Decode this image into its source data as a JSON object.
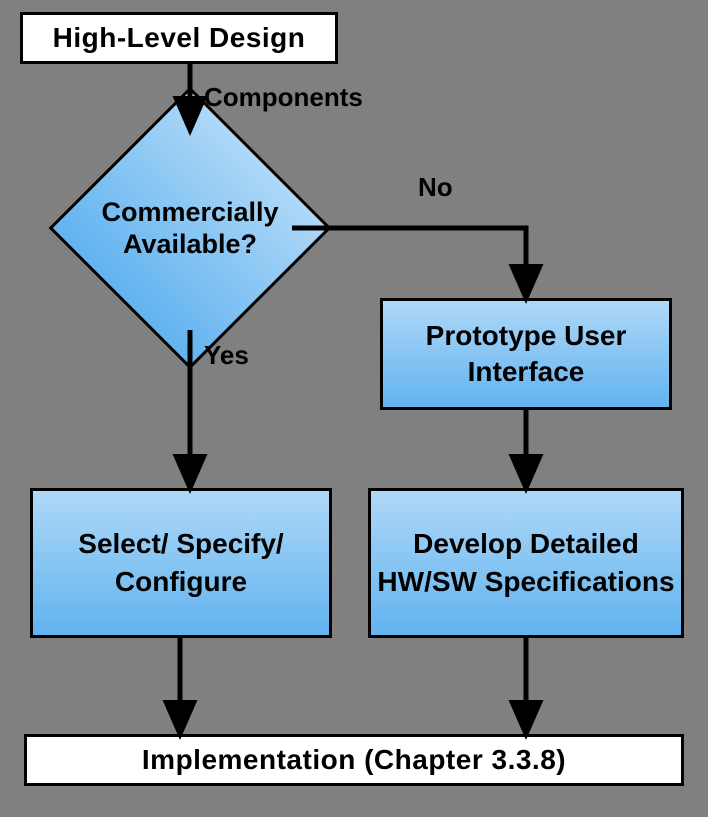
{
  "nodes": {
    "highLevelDesign": "High-Level Design",
    "commerciallyAvailable": "Commercially Available?",
    "prototypeUI": "Prototype User Interface",
    "selectSpecifyConfigure": "Select/ Specify/ Configure",
    "developSpecs": "Develop Detailed HW/SW Specifications",
    "implementation": "Implementation (Chapter 3.3.8)"
  },
  "edgeLabels": {
    "components": "Components",
    "yes": "Yes",
    "no": "No"
  },
  "chart_data": {
    "type": "flowchart",
    "nodes": [
      {
        "id": "hld",
        "type": "terminator",
        "label": "High-Level Design"
      },
      {
        "id": "avail",
        "type": "decision",
        "label": "Commercially Available?"
      },
      {
        "id": "proto",
        "type": "process",
        "label": "Prototype User Interface"
      },
      {
        "id": "sel",
        "type": "process",
        "label": "Select/ Specify/ Configure"
      },
      {
        "id": "spec",
        "type": "process",
        "label": "Develop Detailed HW/SW Specifications"
      },
      {
        "id": "impl",
        "type": "terminator",
        "label": "Implementation (Chapter 3.3.8)"
      }
    ],
    "edges": [
      {
        "from": "hld",
        "to": "avail",
        "label": "Components"
      },
      {
        "from": "avail",
        "to": "sel",
        "label": "Yes"
      },
      {
        "from": "avail",
        "to": "proto",
        "label": "No"
      },
      {
        "from": "proto",
        "to": "spec",
        "label": ""
      },
      {
        "from": "sel",
        "to": "impl",
        "label": ""
      },
      {
        "from": "spec",
        "to": "impl",
        "label": ""
      }
    ]
  }
}
